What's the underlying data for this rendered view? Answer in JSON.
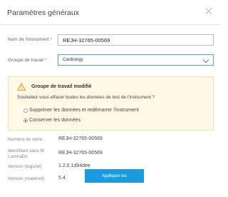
{
  "dialog": {
    "title": "Paramètres généraux"
  },
  "form": {
    "instrument_name_label": "Nom de l'instrument",
    "instrument_name_value": "REJH-32765-00569",
    "workgroup_label": "Groupe de travail",
    "workgroup_value": "Cardiology",
    "required_mark": "*"
  },
  "alert": {
    "title": "Groupe de travail modifié",
    "question": "Souhaitez-vous effacer toutes les données de test de l'instrument ?",
    "options": [
      {
        "label": "Supprimer les données et redémarrer l'instrument",
        "selected": false
      },
      {
        "label": "Conserver les données",
        "selected": true
      }
    ]
  },
  "info": {
    "serial_label": "Numéro de série",
    "serial_value": "REJH-32765-00569",
    "wireless_label_1": "Identifiant sans fil",
    "wireless_label_2": "LumiraDx",
    "wireless_value": "REJH-32765-00569",
    "software_label": "Version (logiciel)",
    "software_value": "1.2.0.1d94dee",
    "hardware_label": "Version (matériel)",
    "hardware_value": "5.4"
  },
  "actions": {
    "apply_label": "Appliquer les modifications"
  },
  "colors": {
    "primary": "#1a9be0",
    "warning": "#f0a020",
    "alert_bg": "#fff9e6"
  }
}
